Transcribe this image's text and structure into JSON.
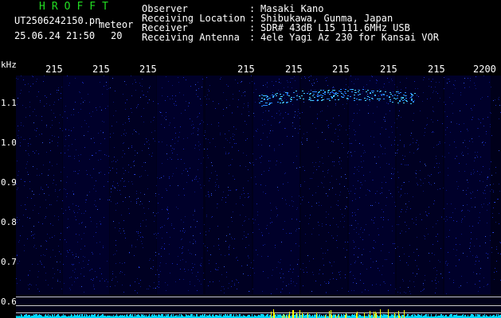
{
  "header": {
    "app_title": "HROFFT",
    "file_name": "UT2506242150.pn",
    "mode": "meteor",
    "date_time": "25.06.24 21:50",
    "count": "20"
  },
  "info": [
    {
      "label": "Observer",
      "value": "Masaki Kano"
    },
    {
      "label": "Receiving Location",
      "value": "Shibukawa, Gunma, Japan"
    },
    {
      "label": "Receiver",
      "value": "SDR# 43dB L15 111.6MHz USB"
    },
    {
      "label": "Receiving Antenna",
      "value": "4ele Yagi Az 230 for Kansai VOR"
    }
  ],
  "axis": {
    "unit": "kHz",
    "x_ticks": [
      "215",
      "215",
      "215",
      "215",
      "215",
      "215",
      "215",
      "215",
      "2200"
    ],
    "y_ticks": [
      "1.1",
      "1.0",
      "0.9",
      "0.8",
      "0.7",
      "0.6"
    ]
  },
  "colors": {
    "background": "#000000",
    "title": "#22dd22",
    "text": "#ffffff",
    "signal": "#44ccff",
    "noise": "#1a2acc",
    "spectrum": "#00d8ff",
    "spectrum_peak": "#ffff00"
  }
}
